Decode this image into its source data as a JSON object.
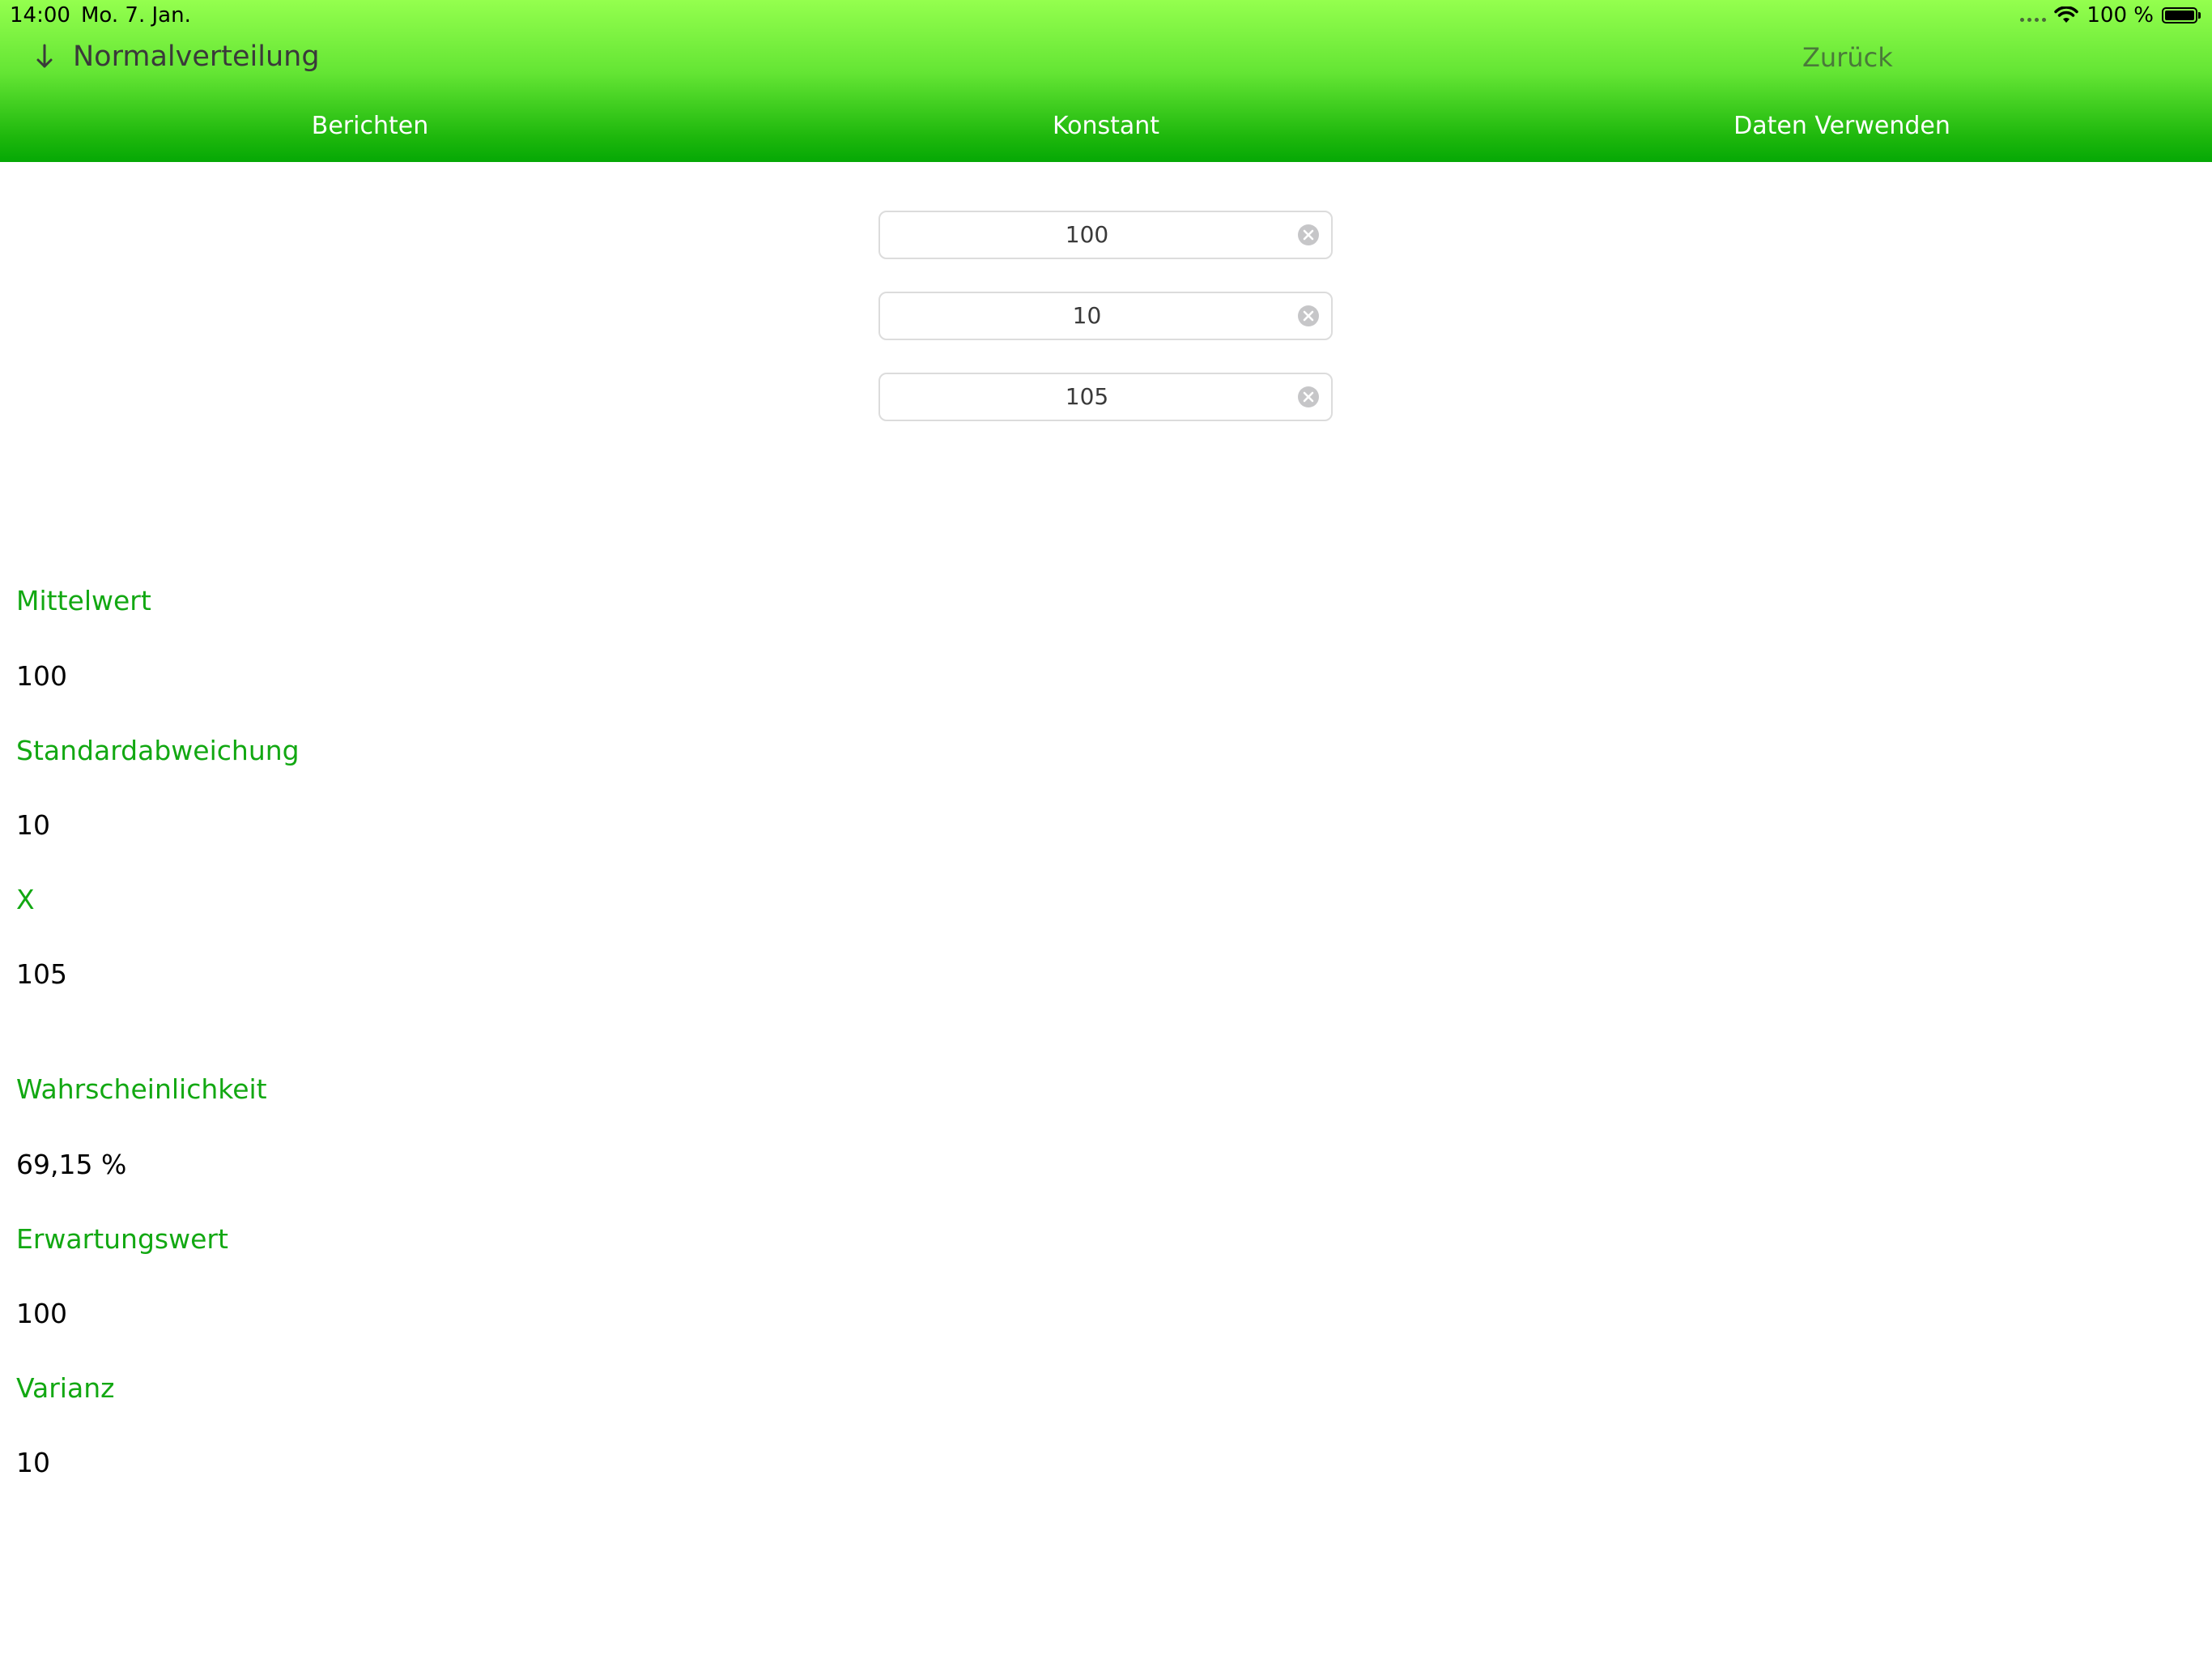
{
  "status_bar": {
    "time": "14:00",
    "date": "Mo. 7. Jan.",
    "battery": "100 %",
    "icons": [
      "signal-dots-icon",
      "wifi-icon",
      "battery-icon"
    ]
  },
  "nav": {
    "title": "Normalverteilung",
    "back_label": "Zurück",
    "arrow_icon": "arrow-down-icon"
  },
  "toolbar": {
    "items": [
      {
        "label": "Berichten"
      },
      {
        "label": "Konstant"
      },
      {
        "label": "Daten Verwenden"
      }
    ]
  },
  "inputs": [
    {
      "value": "100"
    },
    {
      "value": "10"
    },
    {
      "value": "105"
    }
  ],
  "results": [
    {
      "label": "Mittelwert",
      "value": "100"
    },
    {
      "label": "Standardabweichung",
      "value": "10"
    },
    {
      "label": "X",
      "value": "105"
    },
    {
      "label": "Wahrscheinlichkeit",
      "value": "69,15 %"
    },
    {
      "label": "Erwartungswert",
      "value": "100"
    },
    {
      "label": "Varianz",
      "value": "10"
    }
  ],
  "colors": {
    "header_top": "#94ff4e",
    "header_bottom": "#05a805",
    "label_green": "#12a812",
    "value_black": "#000000"
  }
}
